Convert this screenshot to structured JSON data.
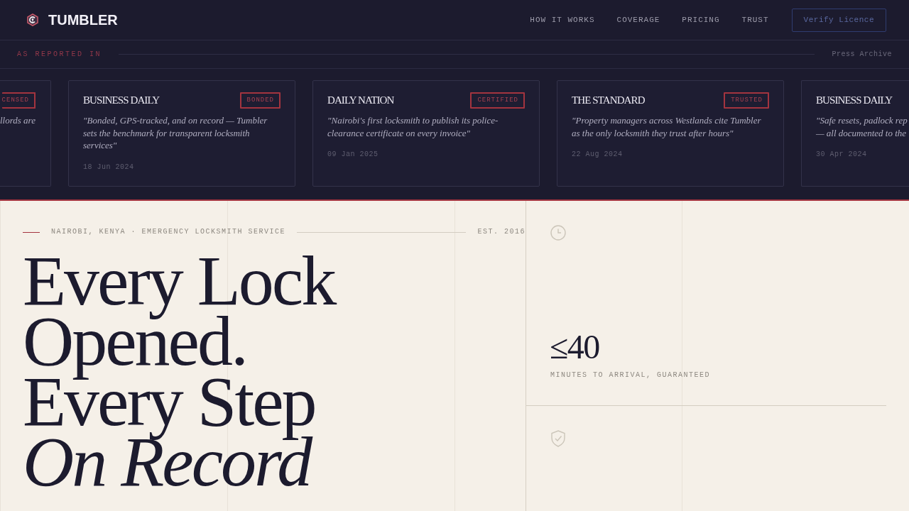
{
  "header": {
    "brand": "TUMBLER",
    "nav": [
      "HOW IT WORKS",
      "COVERAGE",
      "PRICING",
      "TRUST"
    ],
    "cta": "Verify Licence"
  },
  "press": {
    "label": "AS REPORTED IN",
    "archive_link": "Press Archive",
    "cards": [
      {
        "kind": "cut_left",
        "badge": "CENSED",
        "quote_lines": [
          "llords are"
        ]
      },
      {
        "kind": "full",
        "outlet": "BUSINESS DAILY",
        "badge": "BONDED",
        "quote": "\"Bonded, GPS-tracked, and on record — Tumbler sets the benchmark for transparent locksmith services\"",
        "date": "18 Jun 2024"
      },
      {
        "kind": "full",
        "outlet": "DAILY NATION",
        "badge": "CERTIFIED",
        "quote": "\"Nairobi's first locksmith to publish its police-clearance certificate on every invoice\"",
        "date": "09 Jan 2025"
      },
      {
        "kind": "full",
        "outlet": "THE STANDARD",
        "badge": "TRUSTED",
        "quote": "\"Property managers across Westlands cite Tumbler as the only locksmith they trust after hours\"",
        "date": "22 Aug 2024"
      },
      {
        "kind": "cut_right",
        "outlet": "BUSINESS DAILY",
        "quote_lines": [
          "\"Safe resets, padlock rep",
          "— all documented to the"
        ],
        "date": "30 Apr 2024"
      }
    ]
  },
  "hero": {
    "location": "NAIROBI, KENYA · EMERGENCY LOCKSMITH SERVICE",
    "established": "EST. 2016",
    "headline": "Every Lock Opened. Every Step *On Record*",
    "stats": [
      {
        "value": "≤40",
        "label": "MINUTES TO ARRIVAL, GUARANTEED"
      }
    ]
  }
}
